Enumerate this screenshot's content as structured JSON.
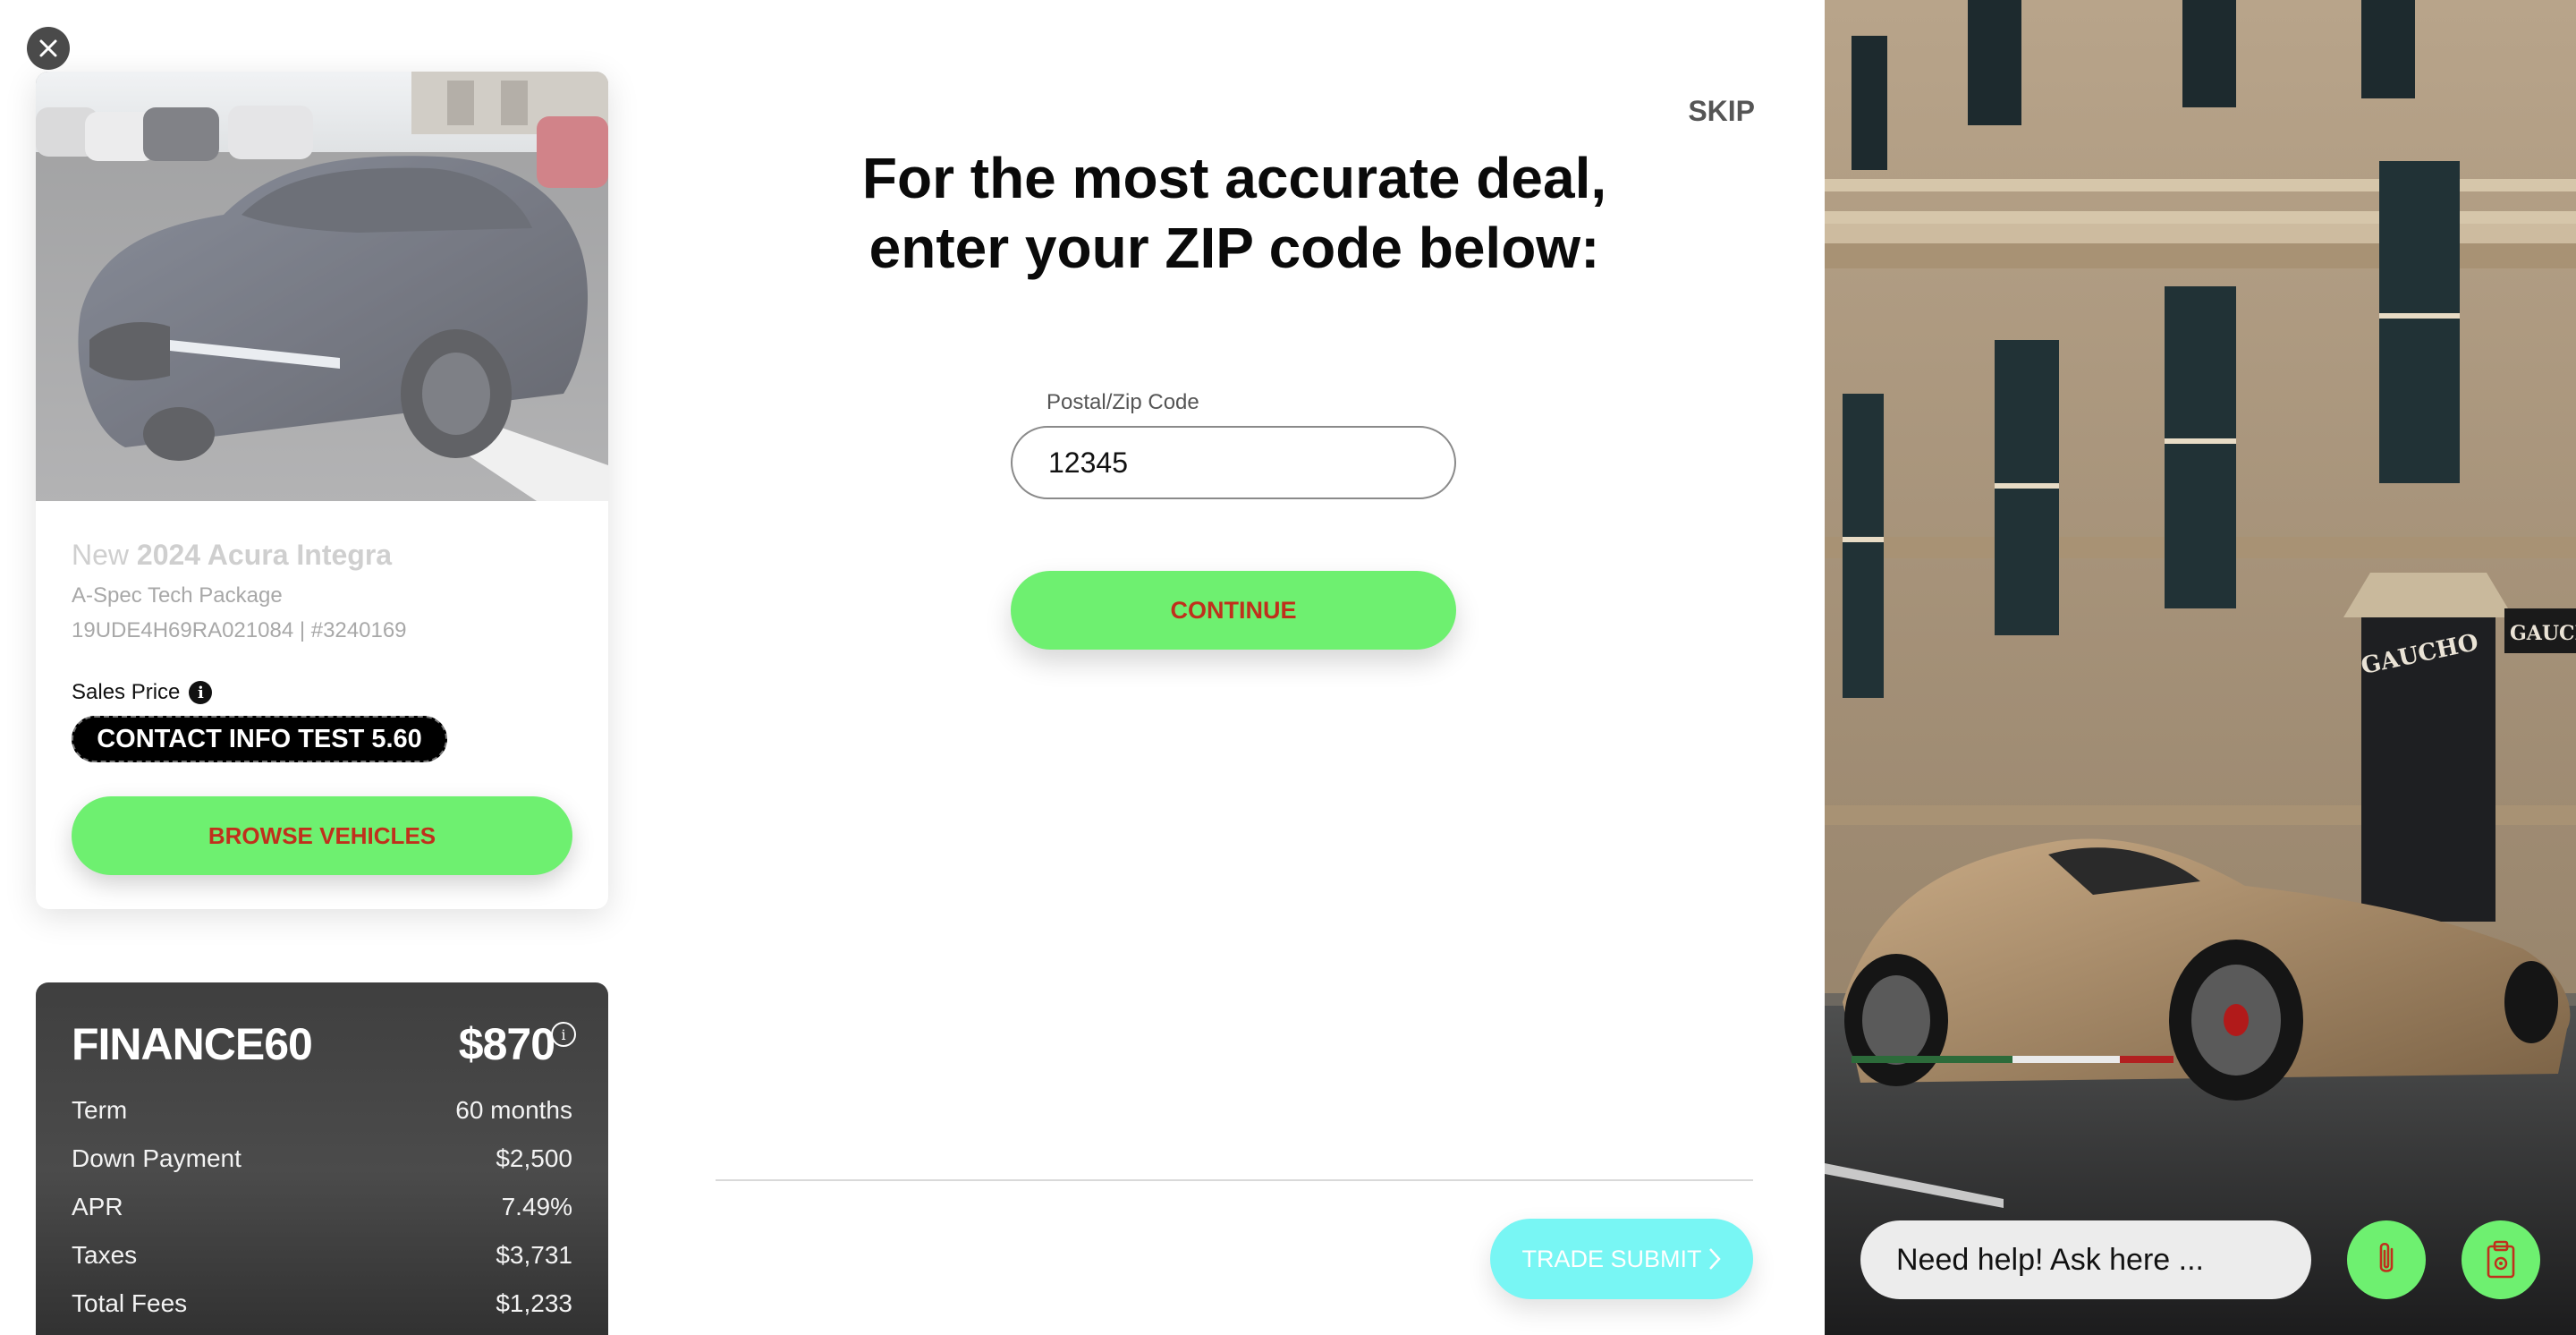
{
  "vehicle": {
    "condition": "New",
    "model": "2024 Acura Integra",
    "trim": "A-Spec Tech Package",
    "vin_stock": "19UDE4H69RA021084 | #3240169",
    "price_label": "Sales Price",
    "price_value": "CONTACT INFO TEST 5.60",
    "browse_label": "BROWSE VEHICLES"
  },
  "finance": {
    "name": "FINANCE60",
    "amount": "$870",
    "rows": [
      {
        "label": "Term",
        "value": "60 months"
      },
      {
        "label": "Down Payment",
        "value": "$2,500"
      },
      {
        "label": "APR",
        "value": "7.49%"
      },
      {
        "label": "Taxes",
        "value": "$3,731"
      },
      {
        "label": "Total Fees",
        "value": "$1,233"
      }
    ]
  },
  "main": {
    "skip_label": "SKIP",
    "heading_line1": "For the most accurate deal,",
    "heading_line2": "enter your ZIP code below:",
    "zip_label": "Postal/Zip Code",
    "zip_value": "12345",
    "continue_label": "CONTINUE",
    "trade_label": "TRADE SUBMIT"
  },
  "side": {
    "storefront_sign": "GAUCHO",
    "help_placeholder": "Need help! Ask here ..."
  },
  "colors": {
    "accent_green": "#6ef070",
    "button_text": "#c0301c",
    "trade_cyan": "#78f6f4",
    "finance_bg": "#3f3f3f"
  },
  "icons": [
    "close-icon",
    "info-icon",
    "chevron-right-icon",
    "paperclip-icon",
    "clipboard-icon"
  ]
}
